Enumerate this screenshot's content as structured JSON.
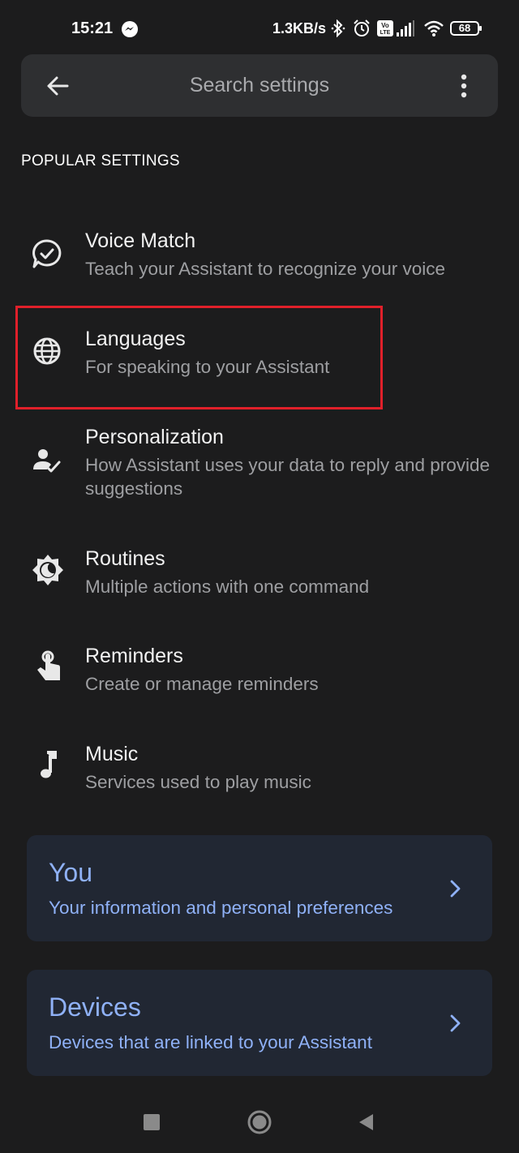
{
  "status_bar": {
    "time": "15:21",
    "network_speed": "1.3KB/s",
    "battery": "68",
    "icons": [
      "messenger-icon",
      "bluetooth-icon",
      "alarm-icon",
      "volte-icon",
      "signal-icon",
      "wifi-icon",
      "battery-icon"
    ]
  },
  "search": {
    "placeholder": "Search settings"
  },
  "section": {
    "header": "POPULAR SETTINGS"
  },
  "settings": [
    {
      "icon": "voice-match-icon",
      "title": "Voice Match",
      "subtitle": "Teach your Assistant to recognize your voice"
    },
    {
      "icon": "globe-icon",
      "title": "Languages",
      "subtitle": "For speaking to your Assistant"
    },
    {
      "icon": "personalization-icon",
      "title": "Personalization",
      "subtitle": "How Assistant uses your data to reply and provide suggestions"
    },
    {
      "icon": "routines-icon",
      "title": "Routines",
      "subtitle": "Multiple actions with one command"
    },
    {
      "icon": "reminders-icon",
      "title": "Reminders",
      "subtitle": "Create or manage reminders"
    },
    {
      "icon": "music-note-icon",
      "title": "Music",
      "subtitle": "Services used to play music"
    }
  ],
  "cards": [
    {
      "title": "You",
      "subtitle": "Your information and personal preferences"
    },
    {
      "title": "Devices",
      "subtitle": "Devices that are linked to your Assistant"
    }
  ],
  "colors": {
    "background": "#1c1c1d",
    "search_bar": "#2e2f31",
    "card_background": "#212733",
    "accent": "#8fb1f7",
    "highlight": "#e0202a"
  }
}
